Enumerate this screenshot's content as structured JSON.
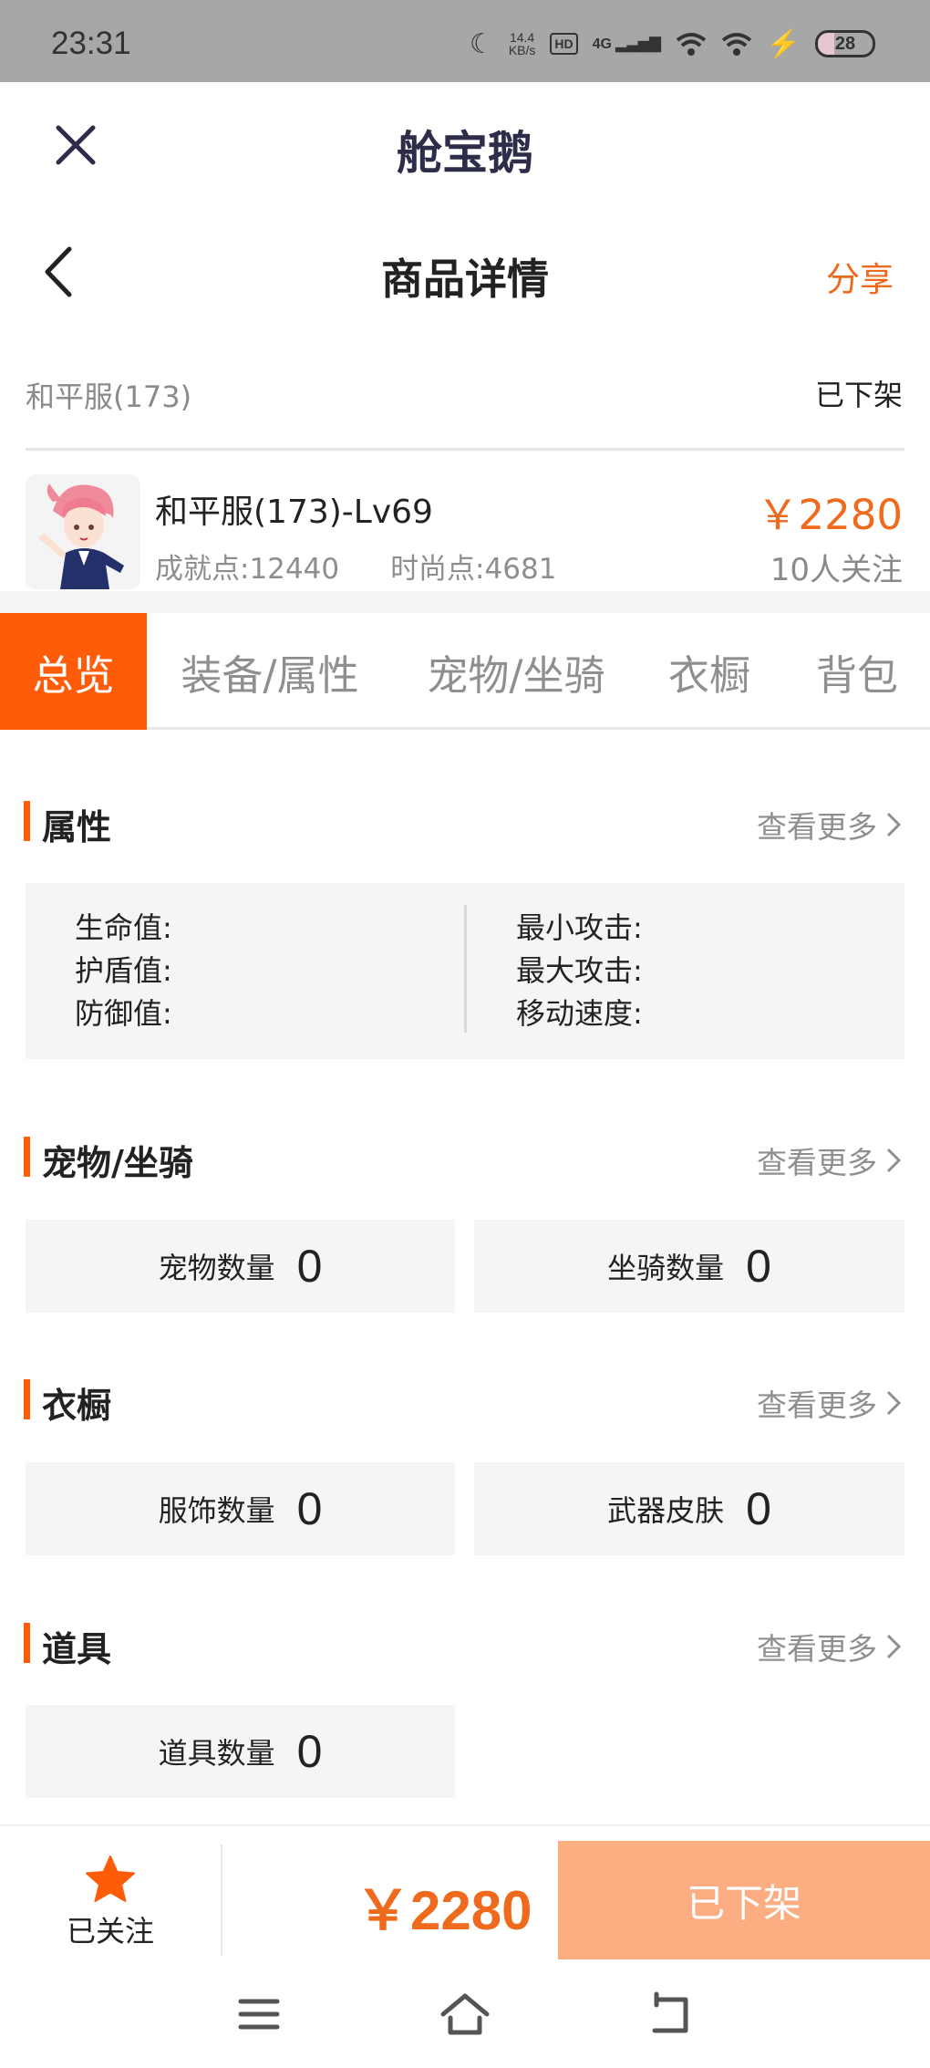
{
  "status_bar": {
    "time": "23:31",
    "speed_value": "14.4",
    "speed_unit": "KB/s",
    "hd": "HD",
    "network": "4G",
    "battery": "28"
  },
  "header": {
    "app_title": "舱宝鹅",
    "page_title": "商品详情",
    "share": "分享"
  },
  "listing": {
    "server": "和平服(173)",
    "status": "已下架",
    "name": "和平服(173)-Lv69",
    "achievement": "成就点:12440",
    "fashion": "时尚点:4681",
    "price": "￥2280",
    "followers": "10人关注"
  },
  "tabs": [
    {
      "label": "总览",
      "active": true
    },
    {
      "label": "装备/属性",
      "active": false
    },
    {
      "label": "宠物/坐骑",
      "active": false
    },
    {
      "label": "衣橱",
      "active": false
    },
    {
      "label": "背包",
      "active": false
    }
  ],
  "sections": {
    "attributes": {
      "title": "属性",
      "more": "查看更多",
      "left": [
        "生命值:",
        "护盾值:",
        "防御值:"
      ],
      "right": [
        "最小攻击:",
        "最大攻击:",
        "移动速度:"
      ]
    },
    "pets": {
      "title": "宠物/坐骑",
      "more": "查看更多",
      "stats": [
        {
          "label": "宠物数量",
          "value": "0"
        },
        {
          "label": "坐骑数量",
          "value": "0"
        }
      ]
    },
    "wardrobe": {
      "title": "衣橱",
      "more": "查看更多",
      "stats": [
        {
          "label": "服饰数量",
          "value": "0"
        },
        {
          "label": "武器皮肤",
          "value": "0"
        }
      ]
    },
    "items": {
      "title": "道具",
      "more": "查看更多",
      "stats": [
        {
          "label": "道具数量",
          "value": "0"
        }
      ]
    }
  },
  "bottom_bar": {
    "follow_label": "已关注",
    "price": "￥2280",
    "button": "已下架"
  },
  "colors": {
    "accent": "#ff5c0a",
    "price": "#ef6a1c",
    "button_disabled": "#fcae82",
    "panel": "#f5f5f5"
  },
  "icons": {
    "close": "close-icon",
    "back": "chevron-left-icon",
    "star": "star-icon",
    "nav_menu": "menu-icon",
    "nav_home": "home-icon",
    "nav_back": "back-icon"
  }
}
